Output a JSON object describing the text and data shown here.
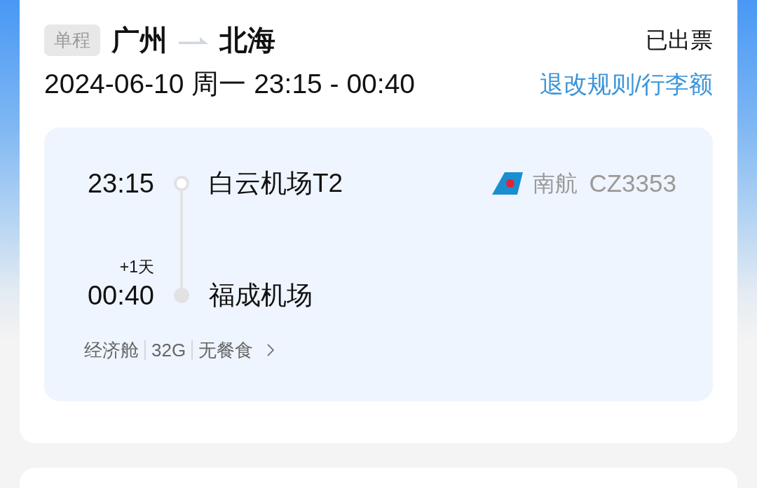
{
  "trip": {
    "type_tag": "单程",
    "origin": "广州",
    "destination": "北海",
    "status": "已出票",
    "date_time": "2024-06-10 周一 23:15 - 00:40",
    "rules_link": "退改规则/行李额"
  },
  "segment": {
    "departure": {
      "time": "23:15",
      "airport": "白云机场T2"
    },
    "arrival": {
      "day_offset": "+1天",
      "time": "00:40",
      "airport": "福成机场"
    },
    "airline": "南航",
    "flight_no": "CZ3353",
    "details": [
      "经济舱",
      "32G",
      "无餐食"
    ]
  }
}
